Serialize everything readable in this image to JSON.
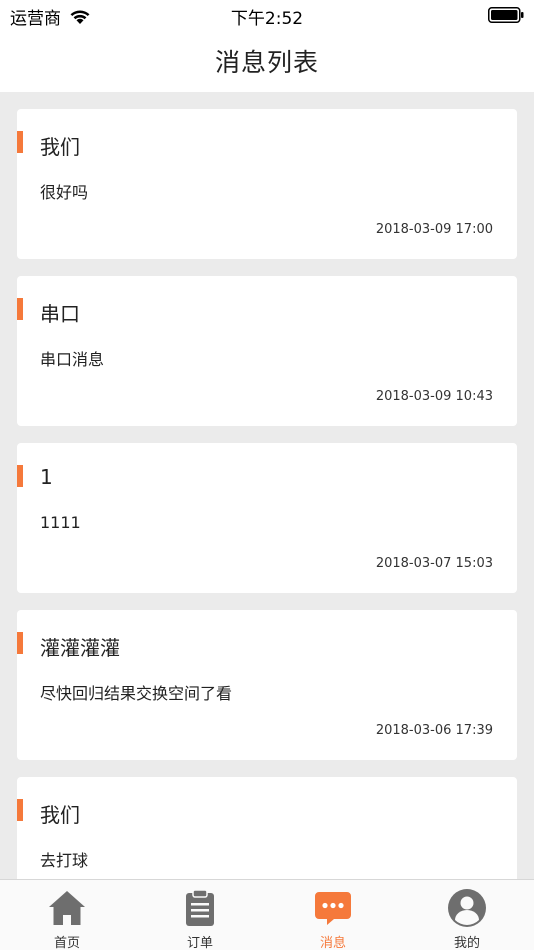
{
  "status_bar": {
    "carrier": "运营商",
    "time": "下午2:52"
  },
  "nav": {
    "title": "消息列表"
  },
  "colors": {
    "accent": "#f5793b",
    "tab_inactive": "#6e6e6e"
  },
  "messages": [
    {
      "title": "我们",
      "body": "很好吗",
      "time": "2018-03-09 17:00"
    },
    {
      "title": "串口",
      "body": "串口消息",
      "time": "2018-03-09 10:43"
    },
    {
      "title": "1",
      "body": "1111",
      "time": "2018-03-07 15:03"
    },
    {
      "title": "灌灌灌灌",
      "body": "尽快回归结果交换空间了看",
      "time": "2018-03-06 17:39"
    },
    {
      "title": "我们",
      "body": "去打球",
      "time": ""
    }
  ],
  "tabs": [
    {
      "label": "首页",
      "icon": "home-icon"
    },
    {
      "label": "订单",
      "icon": "clipboard-icon"
    },
    {
      "label": "消息",
      "icon": "chat-bubble-icon",
      "active": true
    },
    {
      "label": "我的",
      "icon": "user-icon"
    }
  ]
}
